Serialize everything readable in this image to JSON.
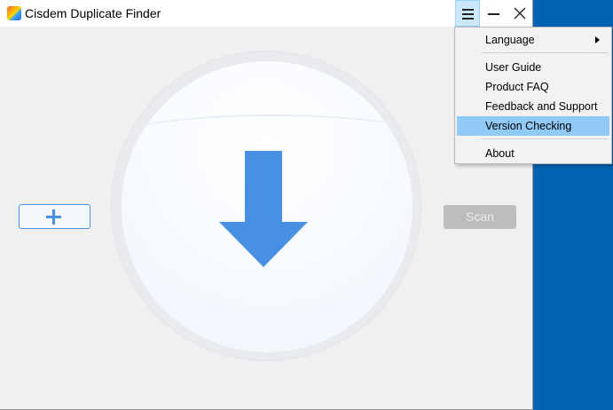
{
  "window": {
    "title": "Cisdem Duplicate Finder",
    "icons": {
      "app": "cisdem-app-icon",
      "menu": "hamburger-menu-icon",
      "minimize": "minimize-icon",
      "close": "close-icon"
    }
  },
  "main": {
    "drop_icon": "down-arrow-icon",
    "add_icon": "plus-icon",
    "scan_label": "Scan"
  },
  "menu": {
    "items": [
      {
        "label": "Language",
        "has_submenu": true
      },
      {
        "label": "User Guide"
      },
      {
        "label": "Product FAQ"
      },
      {
        "label": "Feedback and Support"
      },
      {
        "label": "Version Checking",
        "highlighted": true
      },
      {
        "label": "About"
      }
    ]
  },
  "colors": {
    "accent": "#4a90e2",
    "menu_highlight": "#91c9f7",
    "desktop": "#0063b1",
    "scan_disabled": "#bdbdbd"
  }
}
